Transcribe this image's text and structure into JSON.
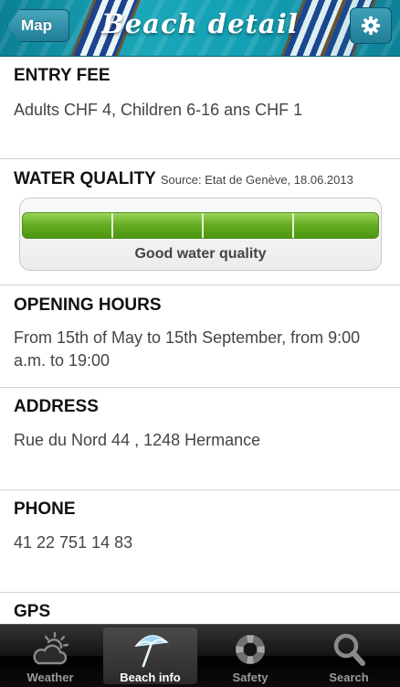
{
  "header": {
    "back_label": "Map",
    "title": "Beach detail",
    "settings_icon": "gear-icon"
  },
  "sections": {
    "entry_fee": {
      "title": "ENTRY FEE",
      "body": "Adults CHF 4, Children 6-16 ans CHF 1"
    },
    "water_quality": {
      "title": "WATER QUALITY",
      "source": "Source: Etat de Genève, 18.06.2013",
      "level": "4/4",
      "status": "Good water quality",
      "bar_color": "#62ab1f"
    },
    "opening_hours": {
      "title": "OPENING HOURS",
      "body": "From 15th of May to 15th September, from 9:00 a.m. to 19:00"
    },
    "address": {
      "title": "ADDRESS",
      "body": "Rue du Nord 44 , 1248 Hermance"
    },
    "phone": {
      "title": "PHONE",
      "body": "41 22 751 14 83"
    },
    "gps": {
      "title": "GPS"
    }
  },
  "tabbar": {
    "tabs": [
      {
        "label": "Weather",
        "icon": "weather-icon",
        "selected": false
      },
      {
        "label": "Beach info",
        "icon": "umbrella-icon",
        "selected": true
      },
      {
        "label": "Safety",
        "icon": "lifebuoy-icon",
        "selected": false
      },
      {
        "label": "Search",
        "icon": "search-icon",
        "selected": false
      }
    ]
  }
}
